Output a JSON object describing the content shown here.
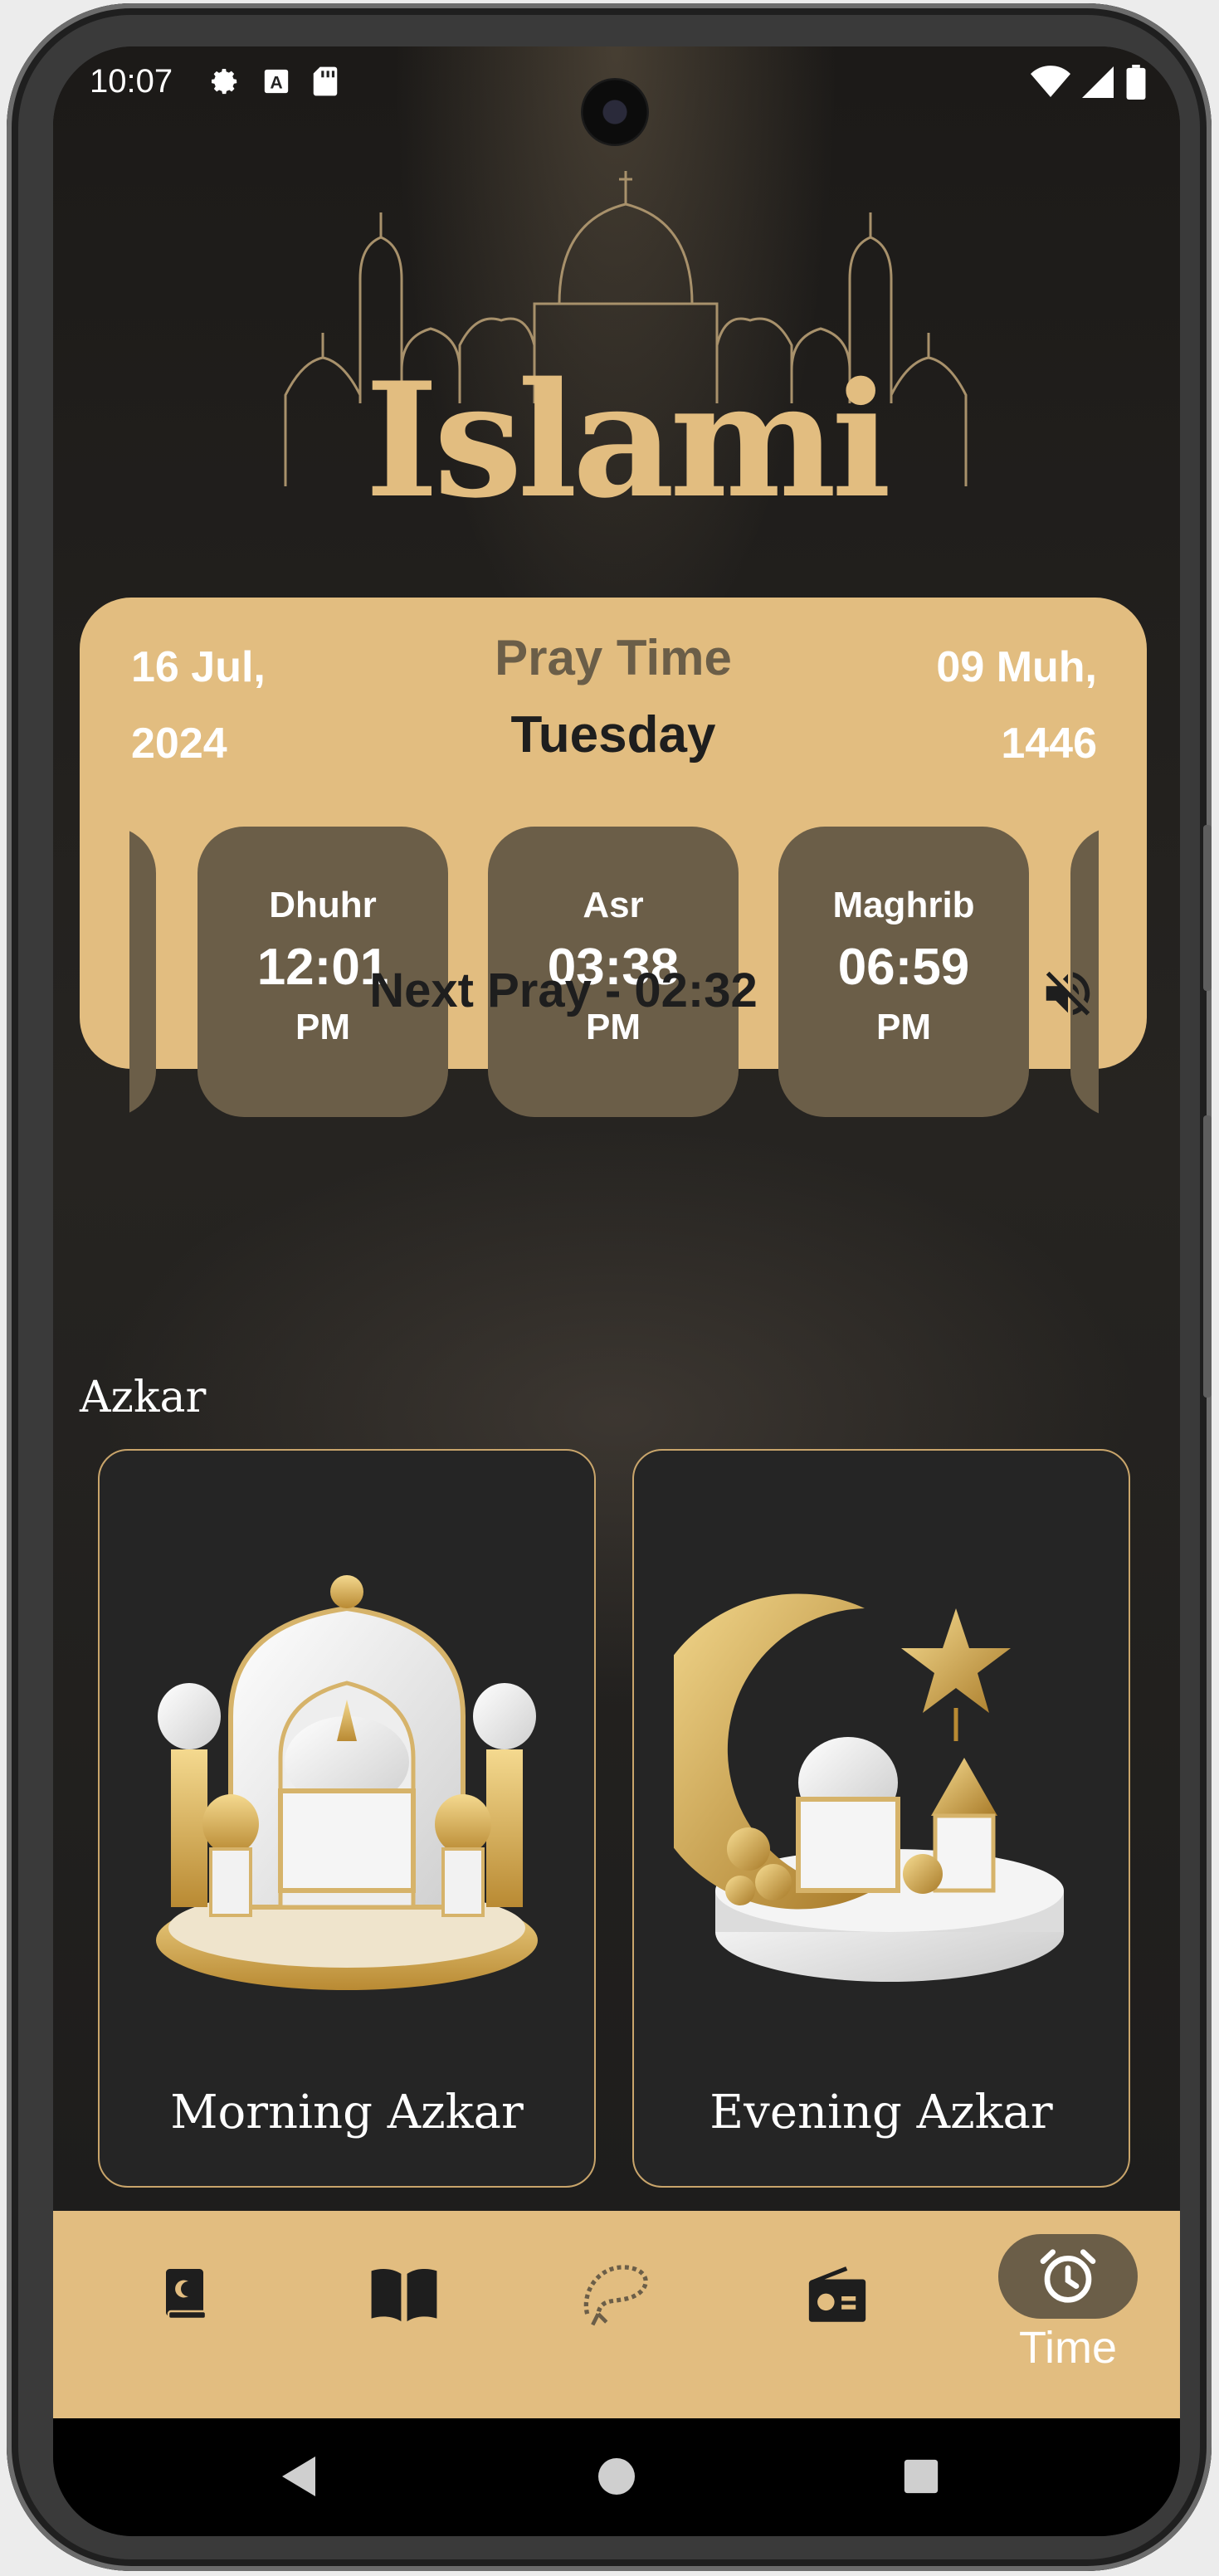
{
  "status_bar": {
    "time": "10:07"
  },
  "app": {
    "logo_text": "Islami"
  },
  "pray_card": {
    "gregorian_date_line1": "16 Jul,",
    "gregorian_date_line2": "2024",
    "title": "Pray Time",
    "weekday": "Tuesday",
    "hijri_date_line1": "09 Muh,",
    "hijri_date_line2": "1446",
    "prayers": [
      {
        "name": "Dhuhr",
        "time": "12:01",
        "period": "PM"
      },
      {
        "name": "Asr",
        "time": "03:38",
        "period": "PM"
      },
      {
        "name": "Maghrib",
        "time": "06:59",
        "period": "PM"
      }
    ],
    "next_pray": "Next Pray - 02:32"
  },
  "azkar": {
    "section_title": "Azkar",
    "cards": [
      {
        "label": "Morning Azkar"
      },
      {
        "label": "Evening Azkar"
      }
    ]
  },
  "bottom_nav": {
    "items": [
      {
        "icon": "quran-icon"
      },
      {
        "icon": "hadith-book-icon"
      },
      {
        "icon": "sebha-icon"
      },
      {
        "icon": "radio-icon"
      },
      {
        "icon": "alarm-clock-icon",
        "label": "Time",
        "active": true
      }
    ]
  },
  "colors": {
    "accent": "#e2bd80",
    "dark_accent": "#6b5e48",
    "background": "#1f1e1c"
  }
}
